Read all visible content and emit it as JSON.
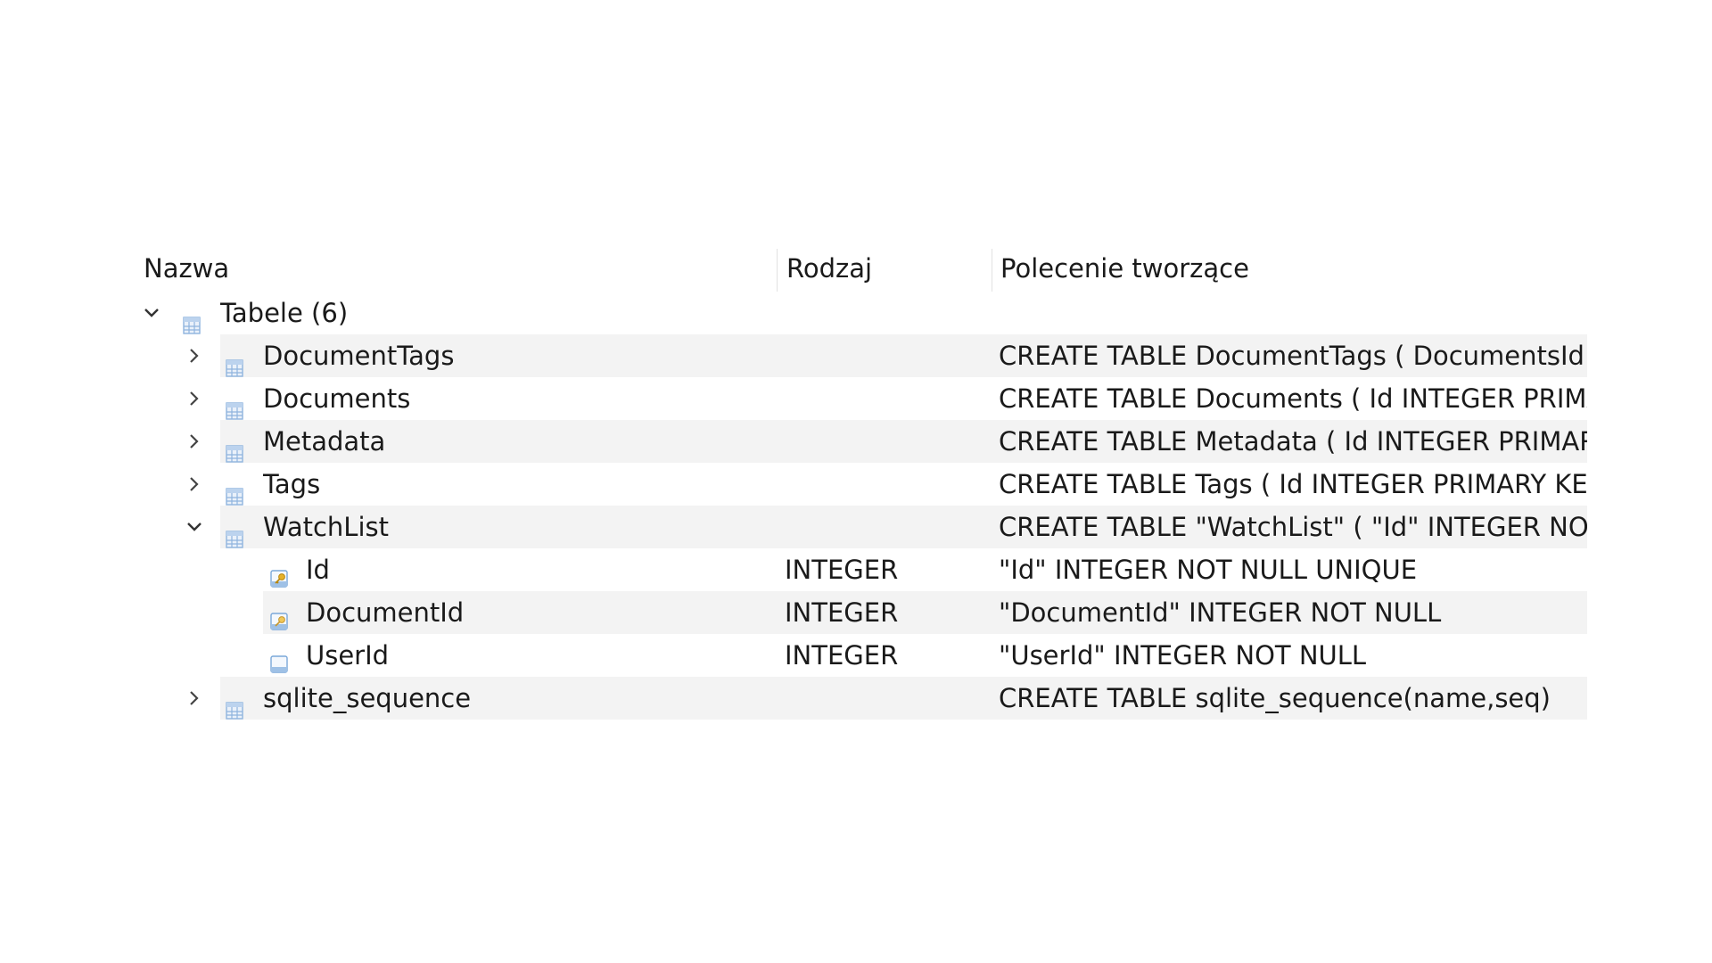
{
  "columns": {
    "name": "Nazwa",
    "type": "Rodzaj",
    "schema": "Polecenie tworzące"
  },
  "root": {
    "label": "Tabele (6)",
    "icon": "table-icon",
    "expanded": true
  },
  "tables": [
    {
      "name": "DocumentTags",
      "schema": "CREATE TABLE DocumentTags ( DocumentsId I",
      "expanded": false,
      "icon": "table-icon"
    },
    {
      "name": "Documents",
      "schema": "CREATE TABLE Documents ( Id INTEGER PRIMA",
      "expanded": false,
      "icon": "table-icon"
    },
    {
      "name": "Metadata",
      "schema": "CREATE TABLE Metadata ( Id INTEGER PRIMAR",
      "expanded": false,
      "icon": "table-icon"
    },
    {
      "name": "Tags",
      "schema": "CREATE TABLE Tags ( Id INTEGER PRIMARY KE",
      "expanded": false,
      "icon": "table-icon"
    },
    {
      "name": "WatchList",
      "schema": "CREATE TABLE \"WatchList\" ( \"Id\" INTEGER NOT",
      "expanded": true,
      "icon": "table-icon",
      "fields": [
        {
          "name": "Id",
          "type": "INTEGER",
          "schema": "\"Id\" INTEGER NOT NULL UNIQUE",
          "icon": "key-field-icon"
        },
        {
          "name": "DocumentId",
          "type": "INTEGER",
          "schema": "\"DocumentId\" INTEGER NOT NULL",
          "icon": "foreign-key-field-icon"
        },
        {
          "name": "UserId",
          "type": "INTEGER",
          "schema": "\"UserId\" INTEGER NOT NULL",
          "icon": "field-icon"
        }
      ]
    },
    {
      "name": "sqlite_sequence",
      "schema": "CREATE TABLE sqlite_sequence(name,seq)",
      "expanded": false,
      "icon": "table-icon"
    }
  ],
  "colors": {
    "band": "#f3f3f3",
    "icon_table": "#8fb4de",
    "icon_field": "#7aa7d9",
    "key_gold": "#d9a520"
  }
}
